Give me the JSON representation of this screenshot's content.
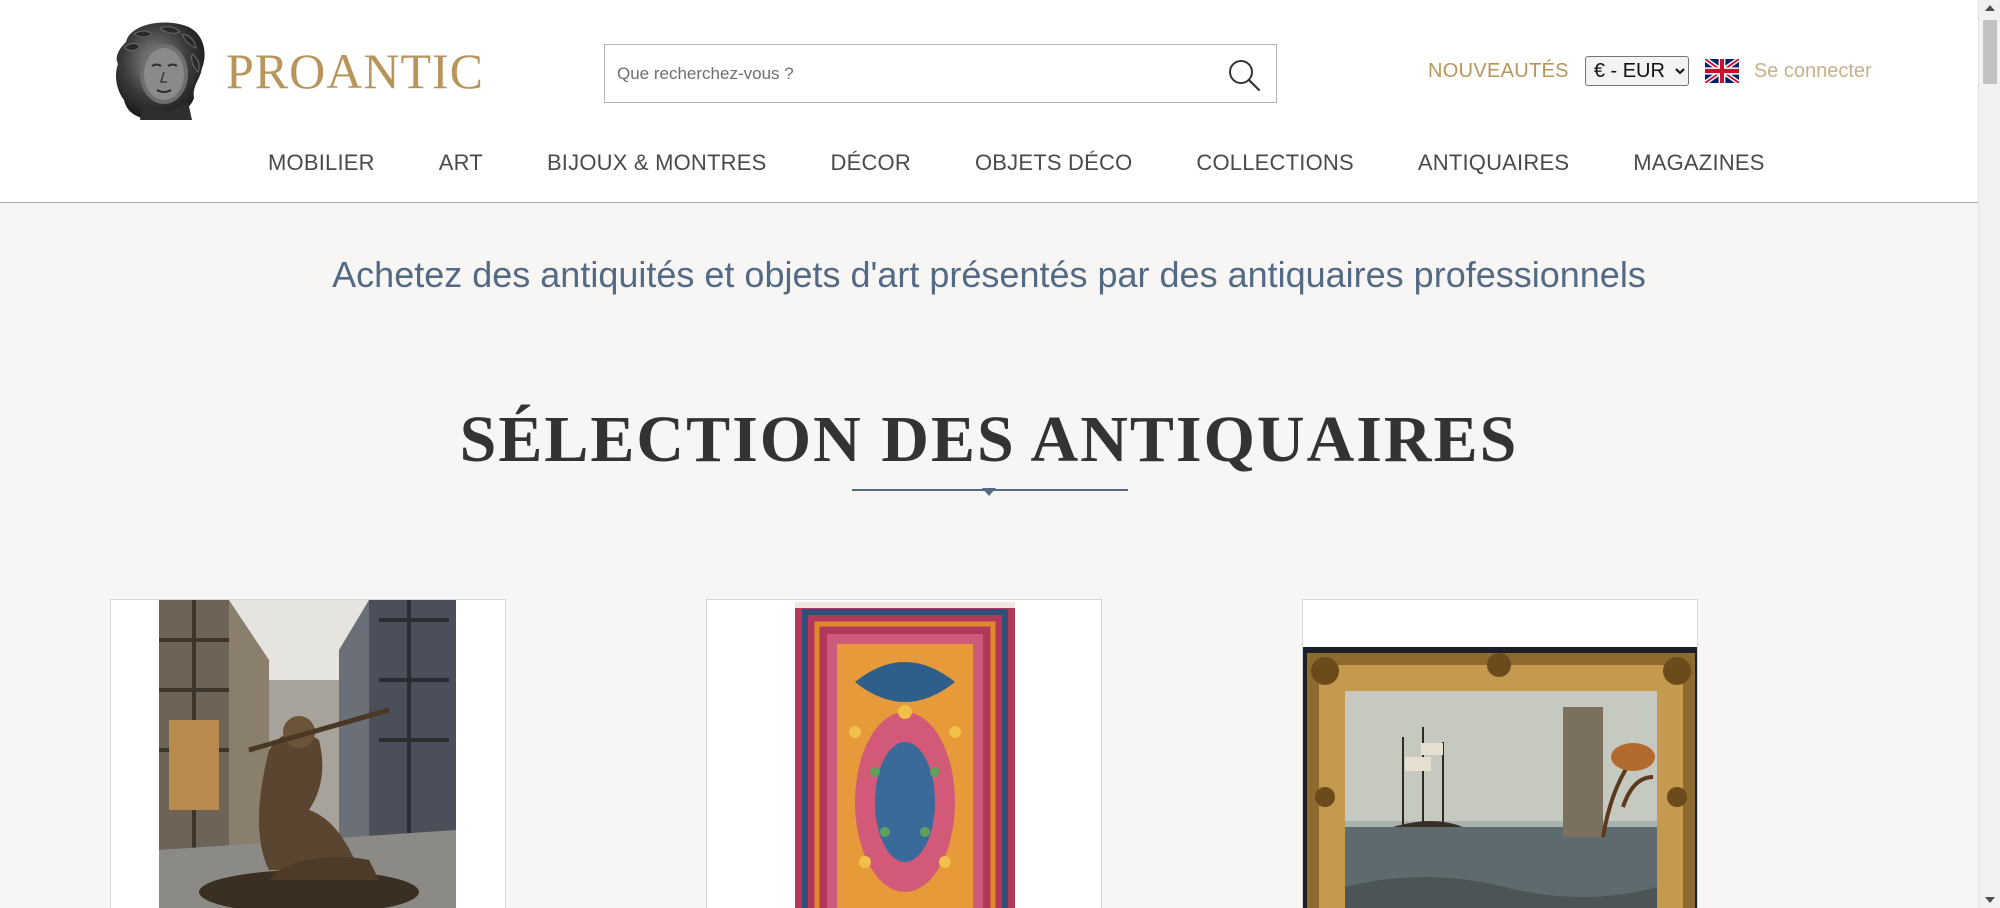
{
  "header": {
    "logo_text": "PROANTIC",
    "search": {
      "placeholder": "Que recherchez-vous ?",
      "value": ""
    },
    "nouveautes_label": "NOUVEAUTÉS",
    "currency": {
      "selected": "€ - EUR",
      "options": [
        "€ - EUR"
      ]
    },
    "language_icon": "uk-flag-icon",
    "login_label": "Se connecter"
  },
  "nav": {
    "items": [
      {
        "label": "MOBILIER"
      },
      {
        "label": "ART"
      },
      {
        "label": "BIJOUX & MONTRES"
      },
      {
        "label": "DÉCOR"
      },
      {
        "label": "OBJETS DÉCO"
      },
      {
        "label": "COLLECTIONS"
      },
      {
        "label": "ANTIQUAIRES"
      },
      {
        "label": "MAGAZINES"
      }
    ]
  },
  "main": {
    "tagline": "Achetez des antiquités et objets d'art présentés par des antiquaires professionnels",
    "section_title": "SÉLECTION DES ANTIQUAIRES",
    "products": [
      {
        "image": "bronze-flute-player-statue-image"
      },
      {
        "image": "persian-rug-image"
      },
      {
        "image": "framed-marine-painting-image"
      }
    ]
  },
  "colors": {
    "brand_gold": "#b8955a",
    "tagline_blue": "#536a85",
    "nav_text": "#4a4a4a",
    "background": "#f7f6f4"
  }
}
